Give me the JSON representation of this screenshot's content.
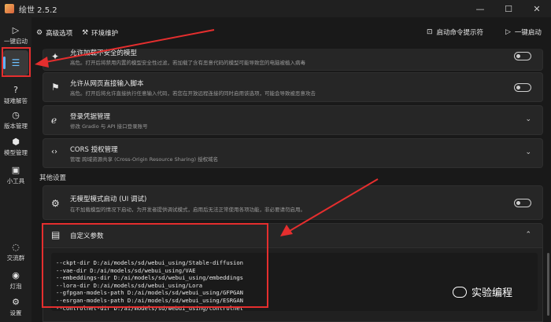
{
  "titlebar": {
    "title": "绘世 2.5.2",
    "minimize": "—",
    "maximize": "☐",
    "close": "✕"
  },
  "sidebar": {
    "items": [
      {
        "icon": "▷",
        "label": "一键启动"
      },
      {
        "icon": "☰",
        "label": ""
      },
      {
        "icon": "?",
        "label": "疑难解答"
      },
      {
        "icon": "◷",
        "label": "版本管理"
      },
      {
        "icon": "⬢",
        "label": "模型管理"
      },
      {
        "icon": "▣",
        "label": "小工具"
      },
      {
        "icon": "◌",
        "label": "交流群"
      },
      {
        "icon": "◉",
        "label": "灯泡"
      },
      {
        "icon": "⚙",
        "label": "设置"
      }
    ]
  },
  "tabs": [
    {
      "icon": "⚙",
      "label": "高级选项"
    },
    {
      "icon": "⚒",
      "label": "环境维护"
    }
  ],
  "toolbar": {
    "console_label": "启动命令提示符",
    "launch_label": "一键启动"
  },
  "cards": [
    {
      "icon": "✦",
      "title": "允许加载不安全的模型",
      "desc": "高危。打开后将禁用内置的模型安全性过滤，若加载了含有恶意代码的模型可能导致您的电脑被植入病毒"
    },
    {
      "icon": "⚑",
      "title": "允许从网页直接输入脚本",
      "desc": "高危。打开后将允许直接执行任意输入代码，若您在开放远程连接的同时启用该选项，可能会导致被恶意攻击"
    },
    {
      "icon": "ℯ",
      "title": "登录凭据管理",
      "desc": "修改 Gradio 与 API 接口登录账号"
    },
    {
      "icon": "‹›",
      "title": "CORS 授权管理",
      "desc": "管理 跨域资源共享 (Cross-Origin Resource Sharing) 授权域名"
    }
  ],
  "other_settings_label": "其他设置",
  "no_model_card": {
    "icon": "⚙",
    "title": "无模型模式启动 (UI 调试)",
    "desc": "在不加载模型的情况下启动，为开发者提供调试模式，启用后无法正常使用各项功能，非必要请勿启用。"
  },
  "custom_args": {
    "icon": "▤",
    "title": "自定义参数",
    "chevron": "⌃",
    "text": "--ckpt-dir D:/ai/models/sd/webui_using/Stable-diffusion\n--vae-dir D:/ai/models/sd/webui_using/VAE\n--embeddings-dir D:/ai/models/sd/webui_using/embeddings\n--lora-dir D:/ai/models/sd/webui_using/Lora\n--gfpgan-models-path D:/ai/models/sd/webui_using/GFPGAN\n--esrgan-models-path D:/ai/models/sd/webui_using/ESRGAN\n--controlnet-dir D:/ai/models/sd/webui_using/controlnet"
  },
  "chevron_glyph": "⌄",
  "watermark": "实验编程",
  "annotation_color": "#e52e2e"
}
